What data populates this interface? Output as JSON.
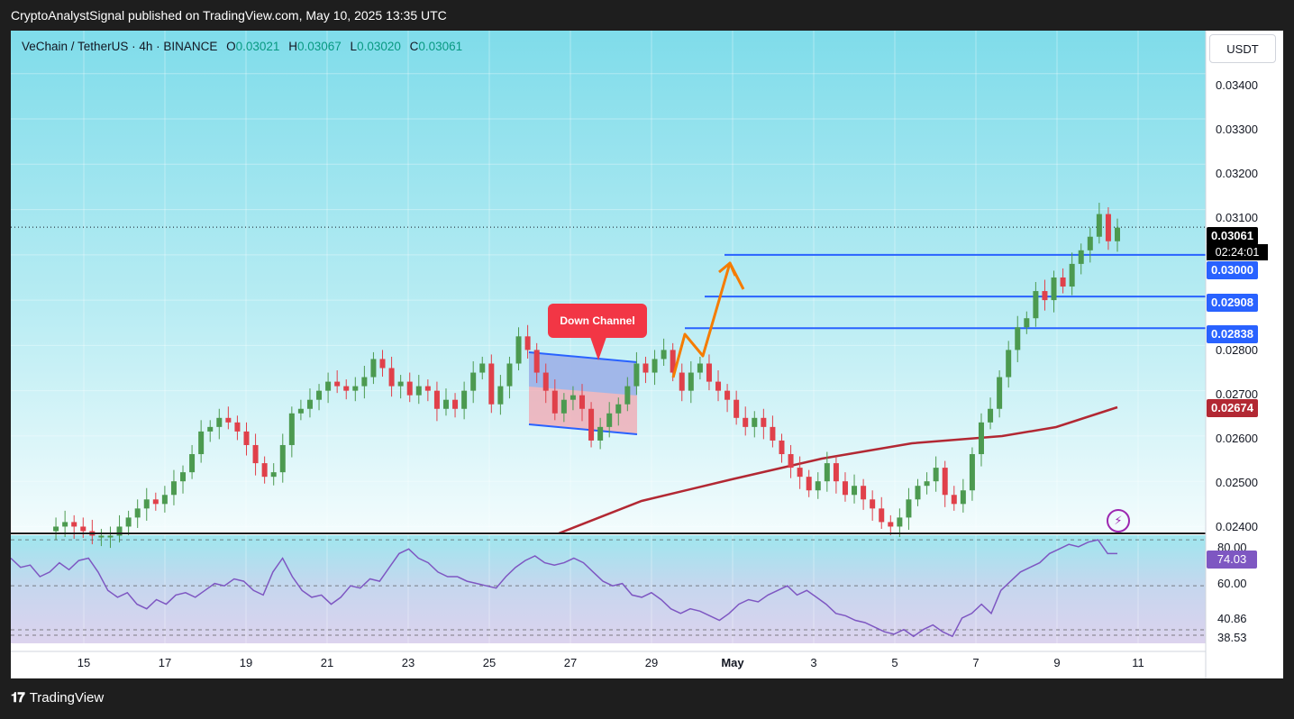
{
  "publish_line": "CryptoAnalystSignal published on TradingView.com, May 10, 2025 13:35 UTC",
  "header": {
    "symbol": "VeChain / TetherUS · 4h · BINANCE",
    "o_label": "O",
    "o_val": "0.03021",
    "h_label": "H",
    "h_val": "0.03067",
    "l_label": "L",
    "l_val": "0.03020",
    "c_label": "C",
    "c_val": "0.03061"
  },
  "unit_button": "USDT",
  "price_axis": [
    "0.03400",
    "0.03300",
    "0.03200",
    "0.03100",
    "0.02800",
    "0.02700",
    "0.02600",
    "0.02500",
    "0.02400"
  ],
  "price_labels": {
    "current": "0.03061",
    "countdown": "02:24:01",
    "level1": "0.03000",
    "level2": "0.02908",
    "level3": "0.02838",
    "ma": "0.02674"
  },
  "rsi_axis": [
    "80.00",
    "60.00",
    "40.86",
    "38.53"
  ],
  "rsi_current": "74.03",
  "date_axis": [
    "15",
    "17",
    "19",
    "21",
    "23",
    "25",
    "27",
    "29",
    "May",
    "3",
    "5",
    "7",
    "9",
    "11"
  ],
  "annotation": "Down Channel",
  "footer_brand": "TradingView",
  "colors": {
    "up": "#4c9a50",
    "down": "#e0404a",
    "level": "#2962ff",
    "ma": "#b22833",
    "rsi": "#7e57c2",
    "arrow": "#f57c00",
    "bg_top": "#7fdcea"
  },
  "chart_data": {
    "type": "candlestick",
    "title": "VeChain / TetherUS · 4h · BINANCE",
    "ylim": [
      0.02385,
      0.03495
    ],
    "levels": [
      0.03,
      0.02908,
      0.02838
    ],
    "ma_last": 0.02674,
    "rsi_ylim": [
      35,
      82
    ],
    "rsi_bands": [
      80,
      60,
      40.86,
      38.53
    ],
    "closes": [
      0.0239,
      0.024,
      0.0241,
      0.024,
      0.0239,
      0.0238,
      0.0238,
      0.0238,
      0.024,
      0.0242,
      0.0244,
      0.0246,
      0.0245,
      0.0247,
      0.025,
      0.0252,
      0.0256,
      0.0261,
      0.0262,
      0.0264,
      0.0263,
      0.0261,
      0.0258,
      0.0254,
      0.0251,
      0.0252,
      0.0258,
      0.0265,
      0.0266,
      0.0268,
      0.027,
      0.0272,
      0.0271,
      0.027,
      0.0271,
      0.0273,
      0.0277,
      0.0275,
      0.0271,
      0.0272,
      0.0269,
      0.0271,
      0.027,
      0.0266,
      0.0268,
      0.0266,
      0.027,
      0.0274,
      0.0276,
      0.0267,
      0.0271,
      0.0276,
      0.0282,
      0.0279,
      0.0274,
      0.027,
      0.0265,
      0.0268,
      0.0269,
      0.0266,
      0.0259,
      0.0262,
      0.0265,
      0.0267,
      0.0271,
      0.0276,
      0.0274,
      0.0277,
      0.0279,
      0.0274,
      0.027,
      0.0274,
      0.0276,
      0.0272,
      0.027,
      0.0268,
      0.0264,
      0.0262,
      0.0264,
      0.0262,
      0.0259,
      0.0256,
      0.0253,
      0.0251,
      0.0248,
      0.025,
      0.0254,
      0.025,
      0.0247,
      0.0249,
      0.0246,
      0.0244,
      0.0241,
      0.024,
      0.0242,
      0.0246,
      0.0249,
      0.025,
      0.0253,
      0.0247,
      0.0245,
      0.0248,
      0.0256,
      0.0263,
      0.0266,
      0.0273,
      0.0279,
      0.0284,
      0.0286,
      0.0292,
      0.029,
      0.0295,
      0.0293,
      0.0298,
      0.0301,
      0.0304,
      0.0309,
      0.0303,
      0.0306
    ],
    "rsi": [
      72,
      68,
      69,
      64,
      66,
      70,
      67,
      71,
      72,
      66,
      58,
      55,
      57,
      52,
      50,
      54,
      52,
      56,
      57,
      55,
      58,
      61,
      60,
      63,
      62,
      58,
      56,
      66,
      72,
      64,
      58,
      55,
      56,
      52,
      55,
      60,
      59,
      63,
      62,
      68,
      74,
      76,
      72,
      70,
      66,
      64,
      64,
      62,
      61,
      60,
      59,
      64,
      68,
      71,
      73,
      70,
      69,
      70,
      72,
      70,
      66,
      62,
      60,
      61,
      56,
      55,
      57,
      54,
      50,
      48,
      50,
      49,
      47,
      45,
      48,
      52,
      54,
      53,
      56,
      58,
      60,
      56,
      58,
      55,
      52,
      48,
      47,
      45,
      44,
      42,
      40,
      39,
      41,
      38,
      41,
      43,
      40,
      38,
      46,
      48,
      52,
      48,
      58,
      62,
      66,
      68,
      70,
      74,
      76,
      78,
      77,
      79,
      80,
      74,
      74
    ]
  }
}
